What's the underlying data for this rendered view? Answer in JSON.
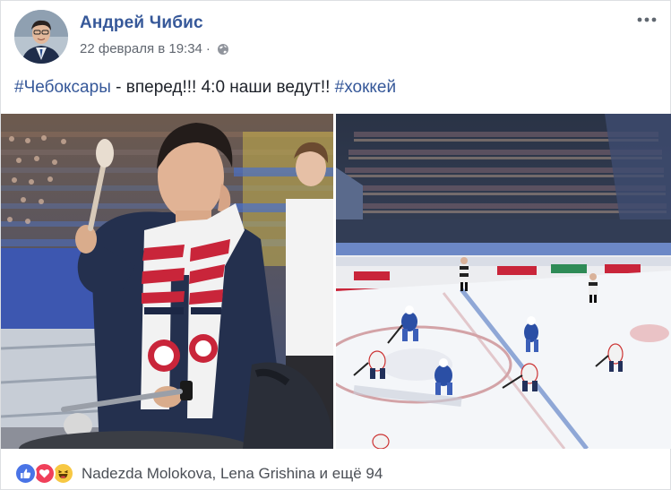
{
  "post": {
    "author": "Андрей Чибис",
    "timestamp": "22 февраля в 19:34",
    "meta_separator": "·",
    "privacy_icon": "globe-icon",
    "more_icon": "ellipsis-icon",
    "text": {
      "hashtag1": "#Чебоксары",
      "body": " - вперед!!! 4:0 наши ведут!! ",
      "hashtag2": "#хоккей"
    },
    "photos": [
      {
        "name": "photo-fan-with-scarf"
      },
      {
        "name": "photo-hockey-rink"
      }
    ],
    "reactions": {
      "icons": [
        "like-icon",
        "love-icon",
        "haha-icon"
      ],
      "summary": "Nadezda Molokova, Lena Grishina и ещё 94"
    }
  },
  "colors": {
    "link": "#365899",
    "text": "#1d2129",
    "meta": "#616770",
    "like": "#4a74e6",
    "love": "#f0405a",
    "haha": "#f7c843"
  }
}
